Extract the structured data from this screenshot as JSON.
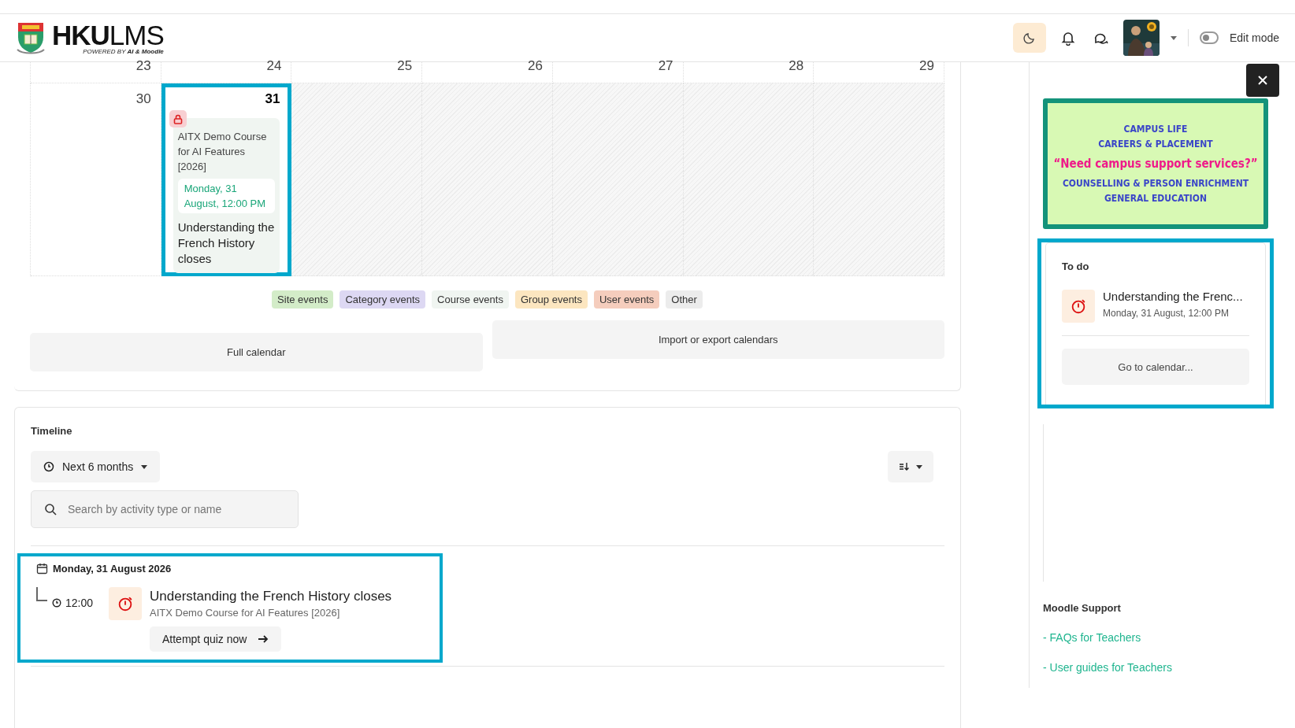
{
  "header": {
    "logo_title": "**HKU**LMS",
    "logo_tagline": "POWERED BY **AI & Moodle**",
    "dark_mode_button": {
      "active": true
    },
    "edit_mode": {
      "label": "Edit mode",
      "on": false
    }
  },
  "calendar": {
    "weeks": [
      {
        "days": [
          {
            "number": "23",
            "today": false,
            "outside": false
          },
          {
            "number": "24",
            "today": false,
            "outside": false
          },
          {
            "number": "25",
            "today": false,
            "outside": false
          },
          {
            "number": "26",
            "today": false,
            "outside": false
          },
          {
            "number": "27",
            "today": false,
            "outside": false
          },
          {
            "number": "28",
            "today": false,
            "outside": false
          },
          {
            "number": "29",
            "today": false,
            "outside": false
          }
        ]
      },
      {
        "days": [
          {
            "number": "30",
            "today": false,
            "outside": false
          },
          {
            "number": "31",
            "today": true,
            "outside": false,
            "highlighted": true,
            "events": [
              {
                "course": "AITX Demo Course for AI Features [2026]",
                "date": "Monday, 31 August, 12:00 PM",
                "name": "Understanding the French History closes"
              }
            ]
          },
          {
            "outside": true
          },
          {
            "outside": true
          },
          {
            "outside": true
          },
          {
            "outside": true
          },
          {
            "outside": true
          }
        ]
      }
    ],
    "legend": [
      {
        "label": "Site events",
        "color": "#d3ecc8"
      },
      {
        "label": "Category events",
        "color": "#ddd8f3"
      },
      {
        "label": "Course events",
        "color": "#f0f5f1"
      },
      {
        "label": "Group events",
        "color": "#fce6c0"
      },
      {
        "label": "User events",
        "color": "#f5cdbd"
      },
      {
        "label": "Other",
        "color": "#ececec"
      }
    ],
    "buttons": [
      "Full calendar",
      "Import or export calendars"
    ]
  },
  "timeline": {
    "title": "Timeline",
    "range_dropdown": "Next 6 months",
    "search": {
      "placeholder": "Search by activity type or name"
    },
    "groups": [
      {
        "date": "Monday, 31 August 2026",
        "highlighted": true,
        "events": [
          {
            "time": "12:00",
            "name": "Understanding the French History closes",
            "course": "AITX Demo Course for AI Features [2026]",
            "action": "Attempt quiz now"
          }
        ]
      }
    ]
  },
  "sidebar": {
    "banner": {
      "lines": [
        "CAMPUS LIFE",
        "CAREERS & PLACEMENT"
      ],
      "headline": "“Need campus support services?”",
      "lines_bottom": [
        "COUNSELLING & PERSON ENRICHMENT",
        "GENERAL EDUCATION"
      ]
    },
    "todo": {
      "title": "To do",
      "highlighted": true,
      "items": [
        {
          "name": "Understanding the Frenc...",
          "date": "Monday, 31 August, 12:00 PM"
        }
      ],
      "button": "Go to calendar..."
    },
    "support": {
      "title": "Moodle Support",
      "links": [
        "- FAQs for Teachers",
        "- User guides for Teachers"
      ]
    }
  }
}
